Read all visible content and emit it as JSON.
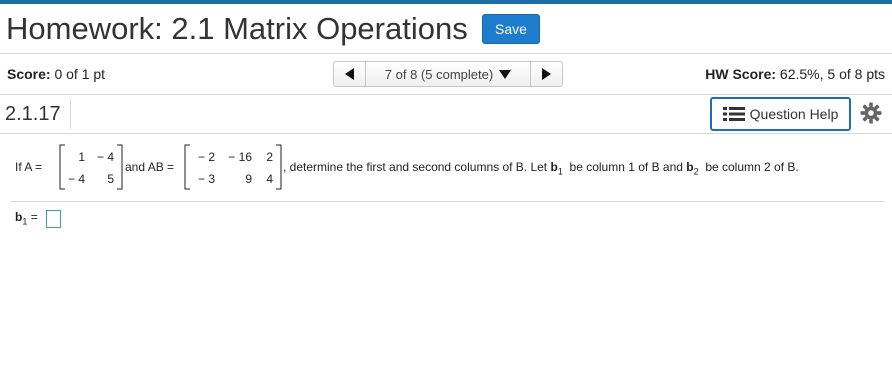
{
  "header": {
    "title": "Homework: 2.1 Matrix Operations",
    "save_label": "Save"
  },
  "score": {
    "label": "Score:",
    "value": "0 of 1 pt",
    "hw_label": "HW Score:",
    "hw_value": "62.5%, 5 of 8 pts"
  },
  "nav": {
    "position_text": "7 of 8 (5 complete)"
  },
  "question": {
    "number": "2.1.17",
    "help_label": "Question Help"
  },
  "problem": {
    "if_a": "If A =",
    "and_ab": "and AB =",
    "rest_1": ", determine the first and second columns of B. Let",
    "b": "b",
    "sub1": "1",
    "be_col1": "be column 1 of B and",
    "sub2": "2",
    "be_col2": "be column 2 of B.",
    "A": [
      [
        "1",
        "− 4"
      ],
      [
        "− 4",
        "5"
      ]
    ],
    "AB": [
      [
        "− 2",
        "− 16",
        "2"
      ],
      [
        "− 3",
        "9",
        "4"
      ]
    ]
  },
  "answer": {
    "b": "b",
    "sub": "1",
    "eq": "="
  },
  "colors": {
    "accent": "#1d7ccc",
    "topbar": "#1a6fa8",
    "help_border": "#1d6fb0"
  }
}
